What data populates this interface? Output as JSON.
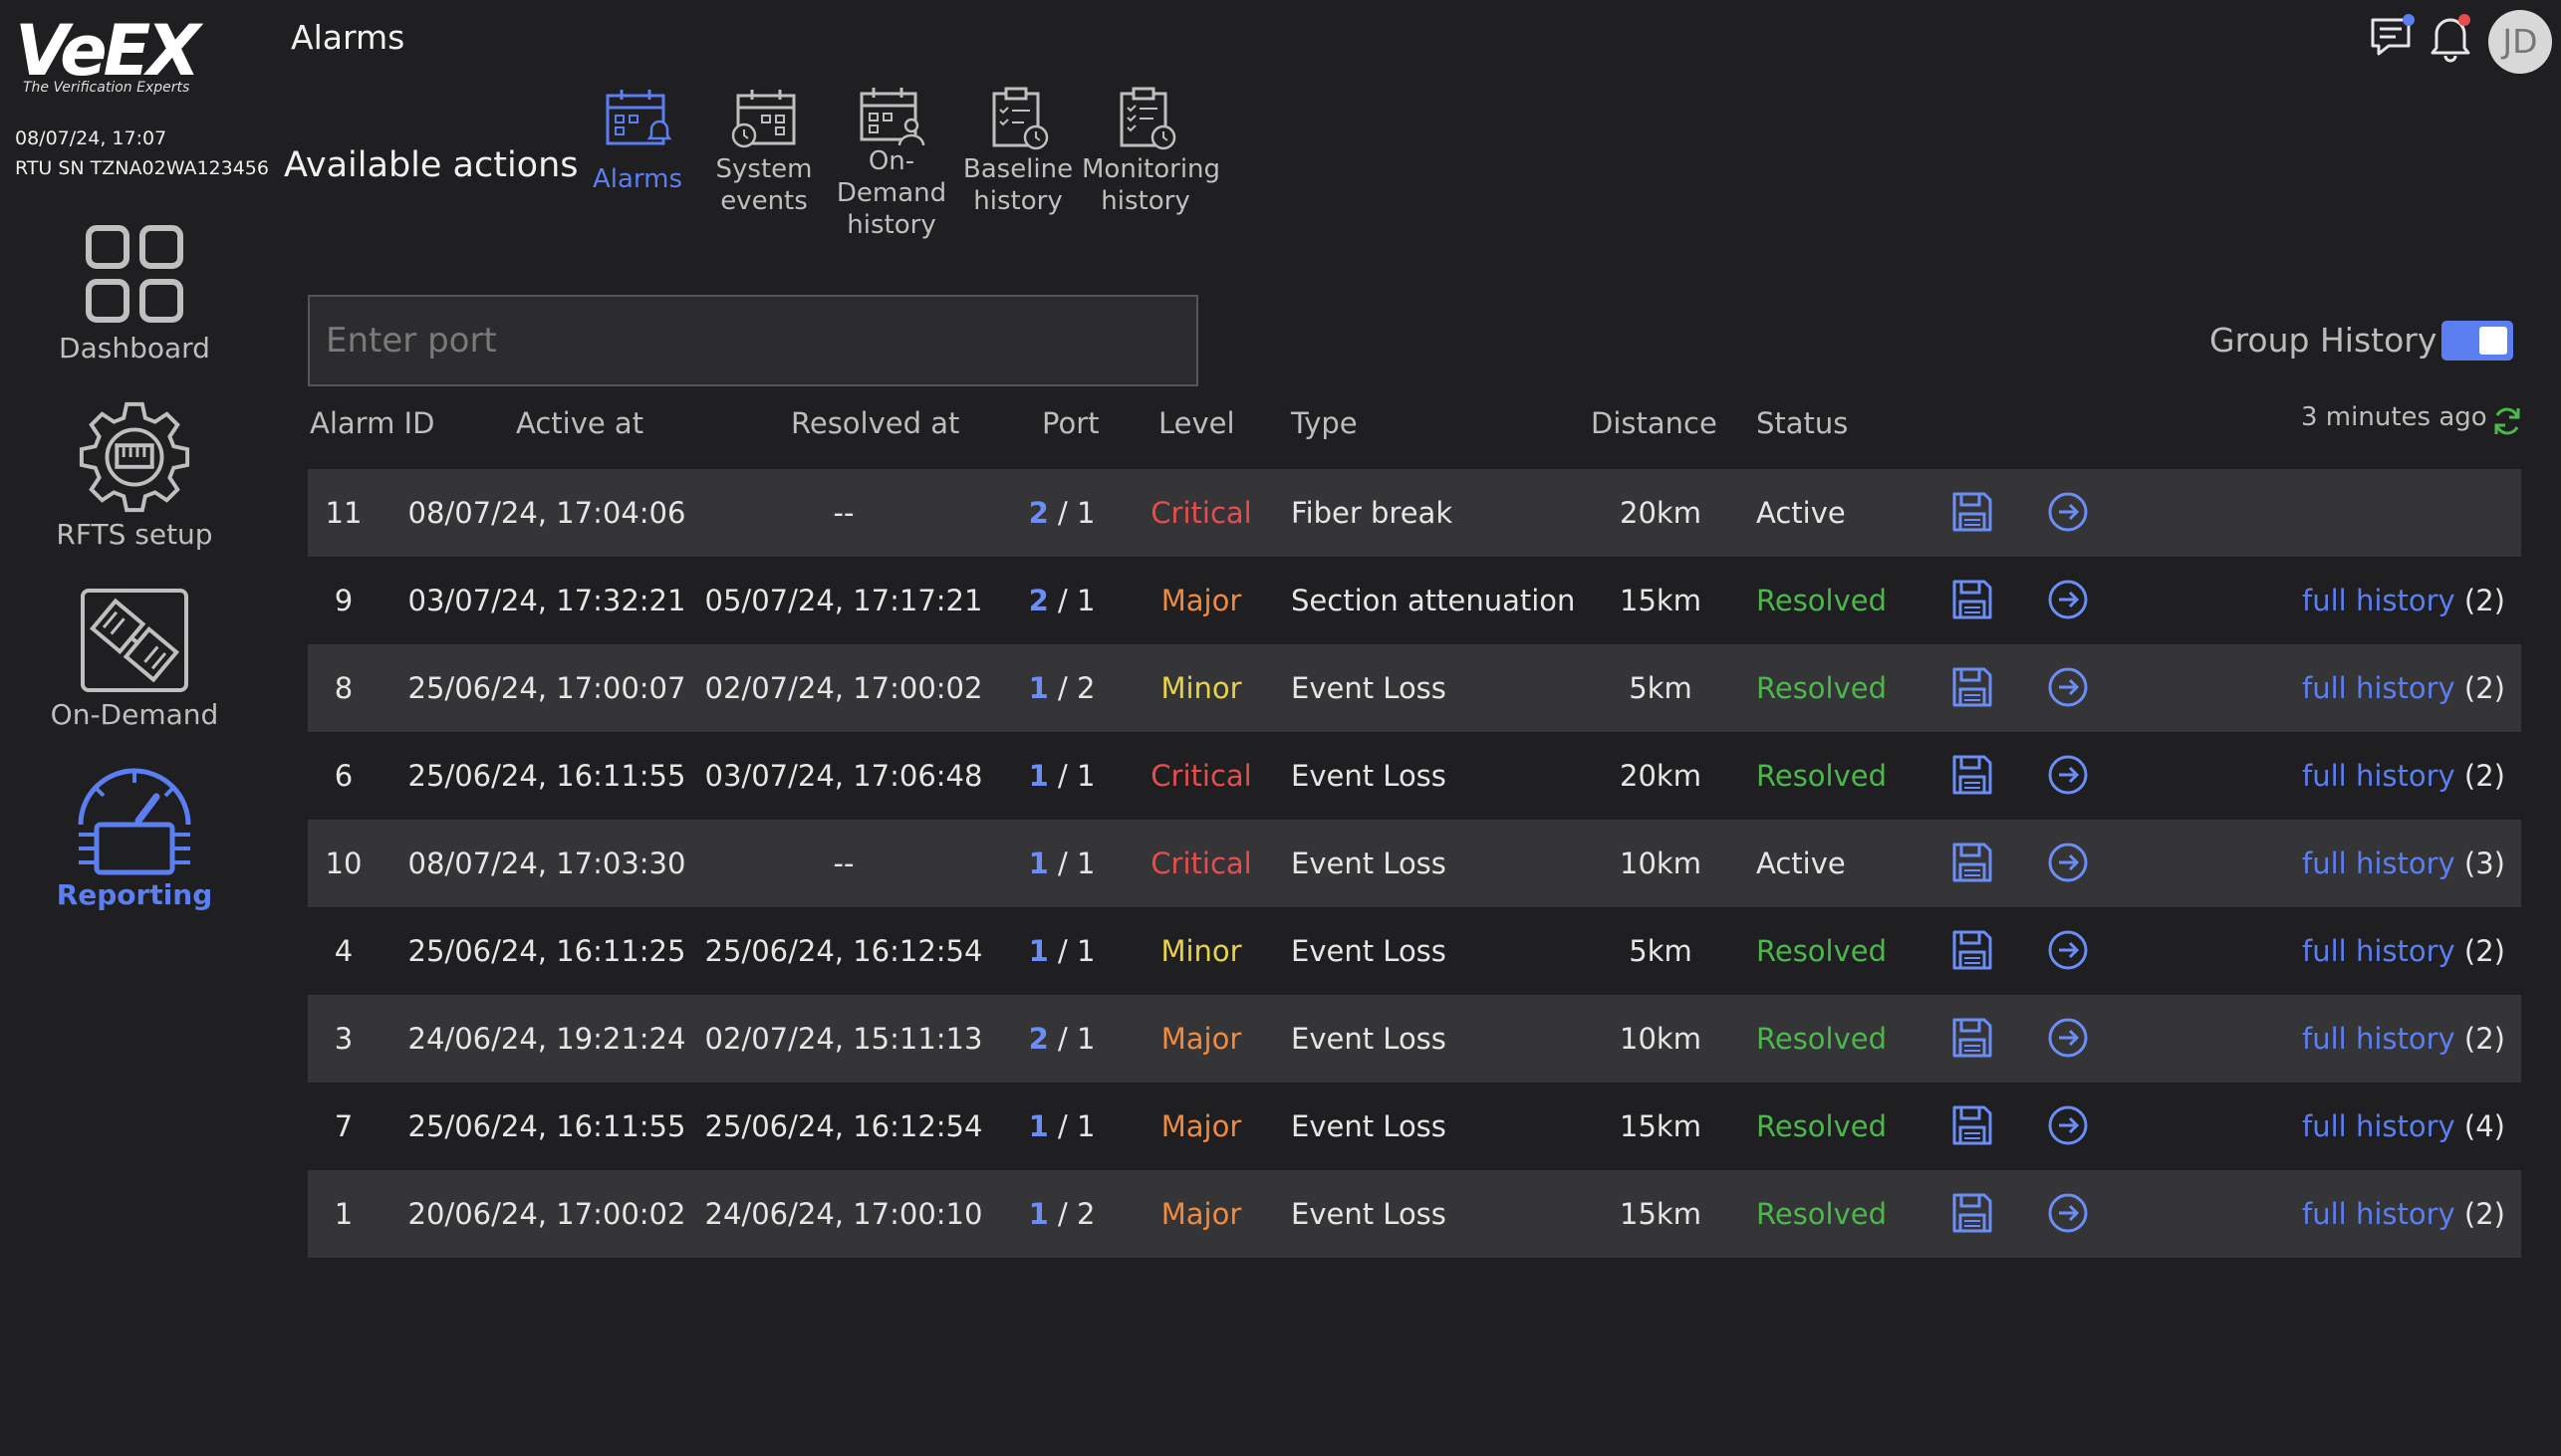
{
  "brand": {
    "logo_text": "VeEX",
    "tagline": "The Verification Experts"
  },
  "device": {
    "datetime": "08/07/24, 17:07",
    "serial": "RTU SN TZNA02WA123456"
  },
  "sidebar": {
    "items": [
      {
        "label": "Dashboard",
        "icon": "grid-icon",
        "active": false
      },
      {
        "label": "RFTS setup",
        "icon": "gear-icon",
        "active": false
      },
      {
        "label": "On-Demand",
        "icon": "on-demand-icon",
        "active": false
      },
      {
        "label": "Reporting",
        "icon": "speedometer-icon",
        "active": true
      }
    ]
  },
  "header": {
    "title": "Alarms",
    "user_initials": "JD"
  },
  "actions": {
    "title": "Available actions",
    "items": [
      {
        "line1": "Alarms",
        "line2": "",
        "line3": "",
        "active": true
      },
      {
        "line1": "System",
        "line2": "events",
        "line3": "",
        "active": false
      },
      {
        "line1": "On-",
        "line2": "Demand",
        "line3": "history",
        "active": false
      },
      {
        "line1": "Baseline",
        "line2": "history",
        "line3": "",
        "active": false
      },
      {
        "line1": "Monitoring",
        "line2": "history",
        "line3": "",
        "active": false
      }
    ]
  },
  "search": {
    "placeholder": "Enter port",
    "value": ""
  },
  "group_history": {
    "label": "Group History",
    "enabled": true
  },
  "last_updated": "3 minutes ago",
  "table": {
    "headers": {
      "alarm_id": "Alarm ID",
      "active_at": "Active at",
      "resolved_at": "Resolved at",
      "port": "Port",
      "level": "Level",
      "type": "Type",
      "distance": "Distance",
      "status": "Status"
    },
    "full_history_label": "full history",
    "rows": [
      {
        "id": "11",
        "active_at": "08/07/24, 17:04:06",
        "resolved_at": "--",
        "port_a": "2",
        "port_b": "/ 1",
        "level": "Critical",
        "type": "Fiber break",
        "distance": "20km",
        "status": "Active",
        "history_count": ""
      },
      {
        "id": "9",
        "active_at": "03/07/24, 17:32:21",
        "resolved_at": "05/07/24, 17:17:21",
        "port_a": "2",
        "port_b": "/ 1",
        "level": "Major",
        "type": "Section attenuation",
        "distance": "15km",
        "status": "Resolved",
        "history_count": "(2)"
      },
      {
        "id": "8",
        "active_at": "25/06/24, 17:00:07",
        "resolved_at": "02/07/24, 17:00:02",
        "port_a": "1",
        "port_b": "/ 2",
        "level": "Minor",
        "type": "Event Loss",
        "distance": "5km",
        "status": "Resolved",
        "history_count": "(2)"
      },
      {
        "id": "6",
        "active_at": "25/06/24, 16:11:55",
        "resolved_at": "03/07/24, 17:06:48",
        "port_a": "1",
        "port_b": "/ 1",
        "level": "Critical",
        "type": "Event Loss",
        "distance": "20km",
        "status": "Resolved",
        "history_count": "(2)"
      },
      {
        "id": "10",
        "active_at": "08/07/24, 17:03:30",
        "resolved_at": "--",
        "port_a": "1",
        "port_b": "/ 1",
        "level": "Critical",
        "type": "Event Loss",
        "distance": "10km",
        "status": "Active",
        "history_count": "(3)"
      },
      {
        "id": "4",
        "active_at": "25/06/24, 16:11:25",
        "resolved_at": "25/06/24, 16:12:54",
        "port_a": "1",
        "port_b": "/ 1",
        "level": "Minor",
        "type": "Event Loss",
        "distance": "5km",
        "status": "Resolved",
        "history_count": "(2)"
      },
      {
        "id": "3",
        "active_at": "24/06/24, 19:21:24",
        "resolved_at": "02/07/24, 15:11:13",
        "port_a": "2",
        "port_b": "/ 1",
        "level": "Major",
        "type": "Event Loss",
        "distance": "10km",
        "status": "Resolved",
        "history_count": "(2)"
      },
      {
        "id": "7",
        "active_at": "25/06/24, 16:11:55",
        "resolved_at": "25/06/24, 16:12:54",
        "port_a": "1",
        "port_b": "/ 1",
        "level": "Major",
        "type": "Event Loss",
        "distance": "15km",
        "status": "Resolved",
        "history_count": "(4)"
      },
      {
        "id": "1",
        "active_at": "20/06/24, 17:00:02",
        "resolved_at": "24/06/24, 17:00:10",
        "port_a": "1",
        "port_b": "/ 2",
        "level": "Major",
        "type": "Event Loss",
        "distance": "15km",
        "status": "Resolved",
        "history_count": "(2)"
      }
    ]
  },
  "colors": {
    "background": "#1f1f21",
    "row_alt": "#353537",
    "accent": "#5b7ef0",
    "critical": "#e64d4d",
    "major": "#f08a3c",
    "minor": "#e8d24a",
    "resolved": "#4cb84c"
  }
}
